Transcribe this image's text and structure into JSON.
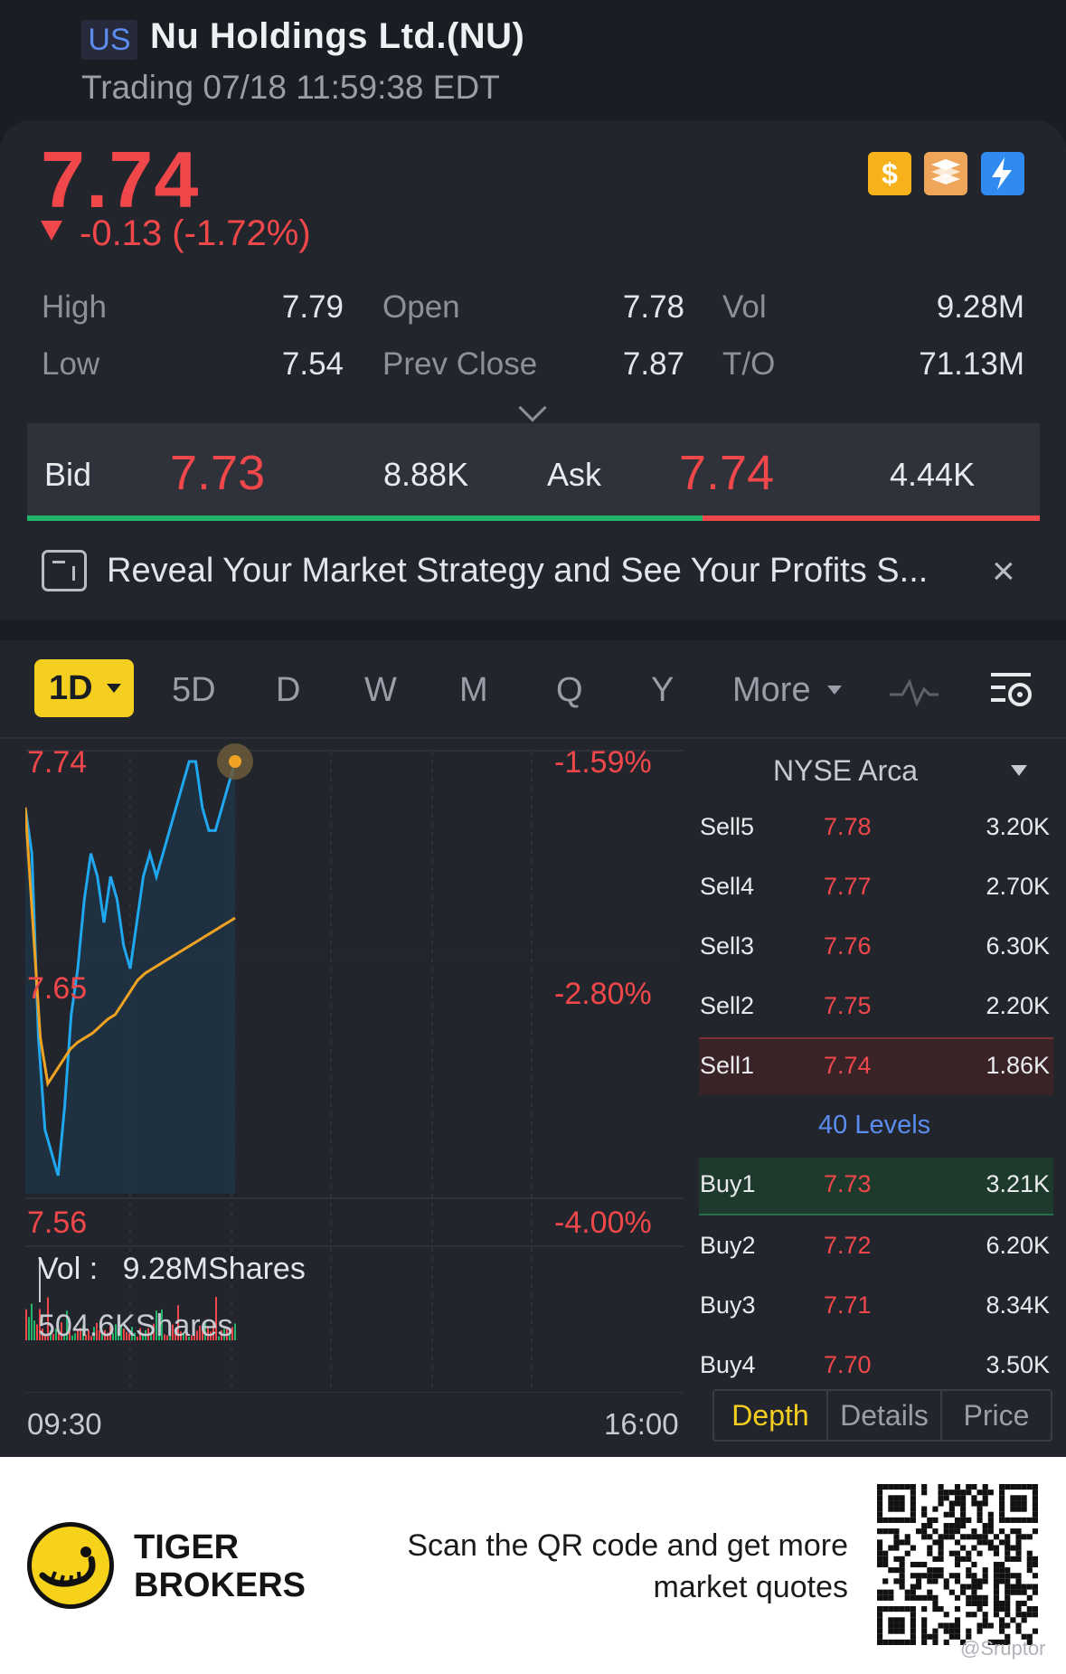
{
  "header": {
    "market_badge": "US",
    "stock_name": "Nu Holdings Ltd.(NU)",
    "trading_status": "Trading 07/18 11:59:38 EDT"
  },
  "quote": {
    "price": "7.74",
    "change": "-0.13 (-1.72%)",
    "direction": "down",
    "icons": [
      "dollar-icon",
      "books-icon",
      "flash-icon"
    ],
    "stats": {
      "high_label": "High",
      "high": "7.79",
      "low_label": "Low",
      "low": "7.54",
      "open_label": "Open",
      "open": "7.78",
      "prev_close_label": "Prev Close",
      "prev_close": "7.87",
      "vol_label": "Vol",
      "vol": "9.28M",
      "to_label": "T/O",
      "to": "71.13M"
    }
  },
  "bid_ask": {
    "bid_label": "Bid",
    "bid_price": "7.73",
    "bid_size": "8.88K",
    "ask_label": "Ask",
    "ask_price": "7.74",
    "ask_size": "4.44K",
    "bid_fraction": 0.667
  },
  "banner": {
    "text": "Reveal Your Market Strategy and See Your Profits S..."
  },
  "period_tabs": {
    "active": "1D",
    "items": [
      "5D",
      "D",
      "W",
      "M",
      "Q",
      "Y"
    ],
    "more": "More"
  },
  "chart": {
    "y_top": "7.74",
    "y_mid": "7.65",
    "y_bottom": "7.56",
    "pct_top": "-1.59%",
    "pct_mid": "-2.80%",
    "pct_bottom": "-4.00%",
    "vol_label": "Vol : ",
    "vol_total": "9.28MShares",
    "vol_max": "504.6KShares",
    "time_start": "09:30",
    "time_end": "16:00"
  },
  "chart_data": {
    "type": "line",
    "title": "",
    "ylim": [
      7.56,
      7.74
    ],
    "x_range": [
      "09:30",
      "16:00"
    ],
    "series": [
      {
        "values": [
          7.72,
          7.7,
          7.62,
          7.58,
          7.57,
          7.56,
          7.59,
          7.63,
          7.65,
          7.68,
          7.7,
          7.69,
          7.67,
          7.69,
          7.68,
          7.66,
          7.65,
          7.67,
          7.69,
          7.7,
          7.69,
          7.7,
          7.71,
          7.72,
          7.73,
          7.74,
          7.74,
          7.72,
          7.71,
          7.71,
          7.72,
          7.73,
          7.74
        ],
        "color": "#1fa8f0"
      },
      {
        "values": [
          7.72,
          7.67,
          7.62,
          7.6,
          7.605,
          7.61,
          7.615,
          7.618,
          7.62,
          7.622,
          7.625,
          7.628,
          7.63,
          7.635,
          7.64,
          7.645,
          7.648,
          7.65,
          7.652,
          7.654,
          7.656,
          7.658,
          7.66,
          7.662,
          7.664,
          7.666,
          7.668,
          7.67,
          7.672
        ],
        "color": "#f0a323"
      }
    ]
  },
  "order_book": {
    "exchange": "NYSE Arca",
    "sells": [
      {
        "label": "Sell5",
        "price": "7.78",
        "size": "3.20K"
      },
      {
        "label": "Sell4",
        "price": "7.77",
        "size": "2.70K"
      },
      {
        "label": "Sell3",
        "price": "7.76",
        "size": "6.30K"
      },
      {
        "label": "Sell2",
        "price": "7.75",
        "size": "2.20K"
      },
      {
        "label": "Sell1",
        "price": "7.74",
        "size": "1.86K"
      }
    ],
    "levels_label": "40 Levels",
    "buys": [
      {
        "label": "Buy1",
        "price": "7.73",
        "size": "3.21K"
      },
      {
        "label": "Buy2",
        "price": "7.72",
        "size": "6.20K"
      },
      {
        "label": "Buy3",
        "price": "7.71",
        "size": "8.34K"
      },
      {
        "label": "Buy4",
        "price": "7.70",
        "size": "3.50K"
      }
    ],
    "tabs": [
      "Depth",
      "Details",
      "Price"
    ],
    "active_tab": "Depth"
  },
  "footer": {
    "brand_line1": "TIGER",
    "brand_line2": "BROKERS",
    "text_line1": "Scan the QR code and get more",
    "text_line2": "market quotes",
    "watermark": "@Sruptor"
  },
  "colors": {
    "up": "#23b36a",
    "down": "#f0474a",
    "accent": "#f4cf1f",
    "link": "#5b8cf0"
  }
}
